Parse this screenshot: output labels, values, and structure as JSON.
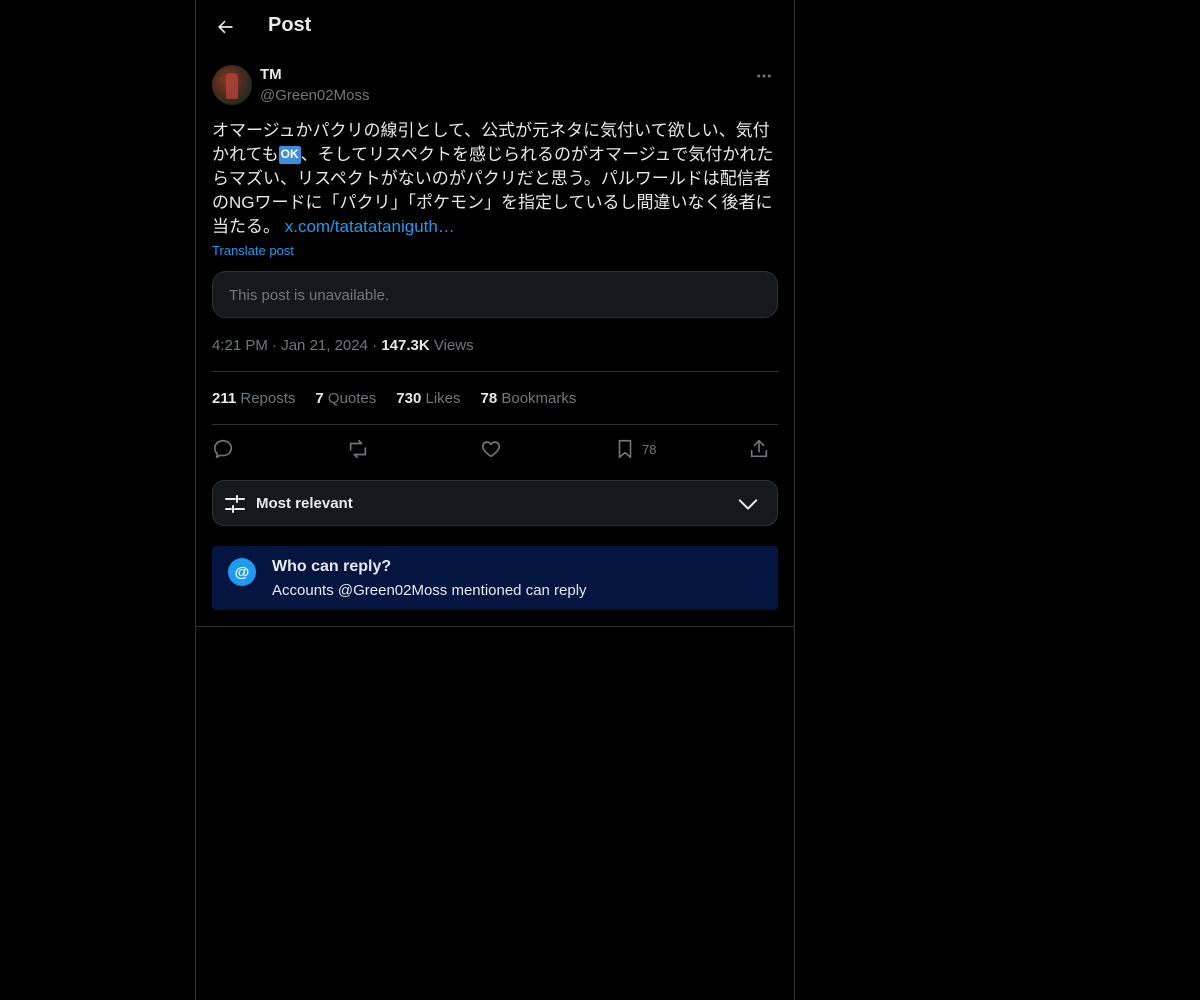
{
  "header": {
    "title": "Post"
  },
  "author": {
    "name": "TM",
    "handle": "@Green02Moss"
  },
  "post": {
    "text_part1": "オマージュかパクリの線引として、公式が元ネタに気付いて欲しい、気付かれても",
    "ok_badge": "OK",
    "text_part2": "、そしてリスペクトを感じられるのがオマージュで気付かれたらマズい、リスペクトがないのがパクリだと思う。パルワールドは配信者のNGワードに「パクリ」「ポケモン」を指定しているし間違いなく後者に当たる。 ",
    "link": "x.com/tatatataniguth…",
    "translate": "Translate post",
    "unavailable": "This post is unavailable."
  },
  "meta": {
    "time": "4:21 PM",
    "dot1": " · ",
    "date": "Jan 21, 2024",
    "dot2": " · ",
    "views_count": "147.3K",
    "views_label": " Views"
  },
  "stats": {
    "reposts_count": "211",
    "reposts_label": " Reposts",
    "quotes_count": "7",
    "quotes_label": " Quotes",
    "likes_count": "730",
    "likes_label": " Likes",
    "bookmarks_count": "78",
    "bookmarks_label": " Bookmarks"
  },
  "actions": {
    "reply_icon": "reply-icon",
    "repost_icon": "repost-icon",
    "like_icon": "heart-icon",
    "bookmark_icon": "bookmark-icon",
    "bookmark_count": "78",
    "share_icon": "share-icon"
  },
  "sort": {
    "label": "Most relevant"
  },
  "reply_restriction": {
    "icon_text": "@",
    "title": "Who can reply?",
    "subtitle": "Accounts @Green02Moss mentioned can reply"
  },
  "colors": {
    "background": "#000000",
    "text": "#e7e9ea",
    "muted": "#71767b",
    "accent": "#1d9bf0",
    "reply_box": "#031540"
  }
}
